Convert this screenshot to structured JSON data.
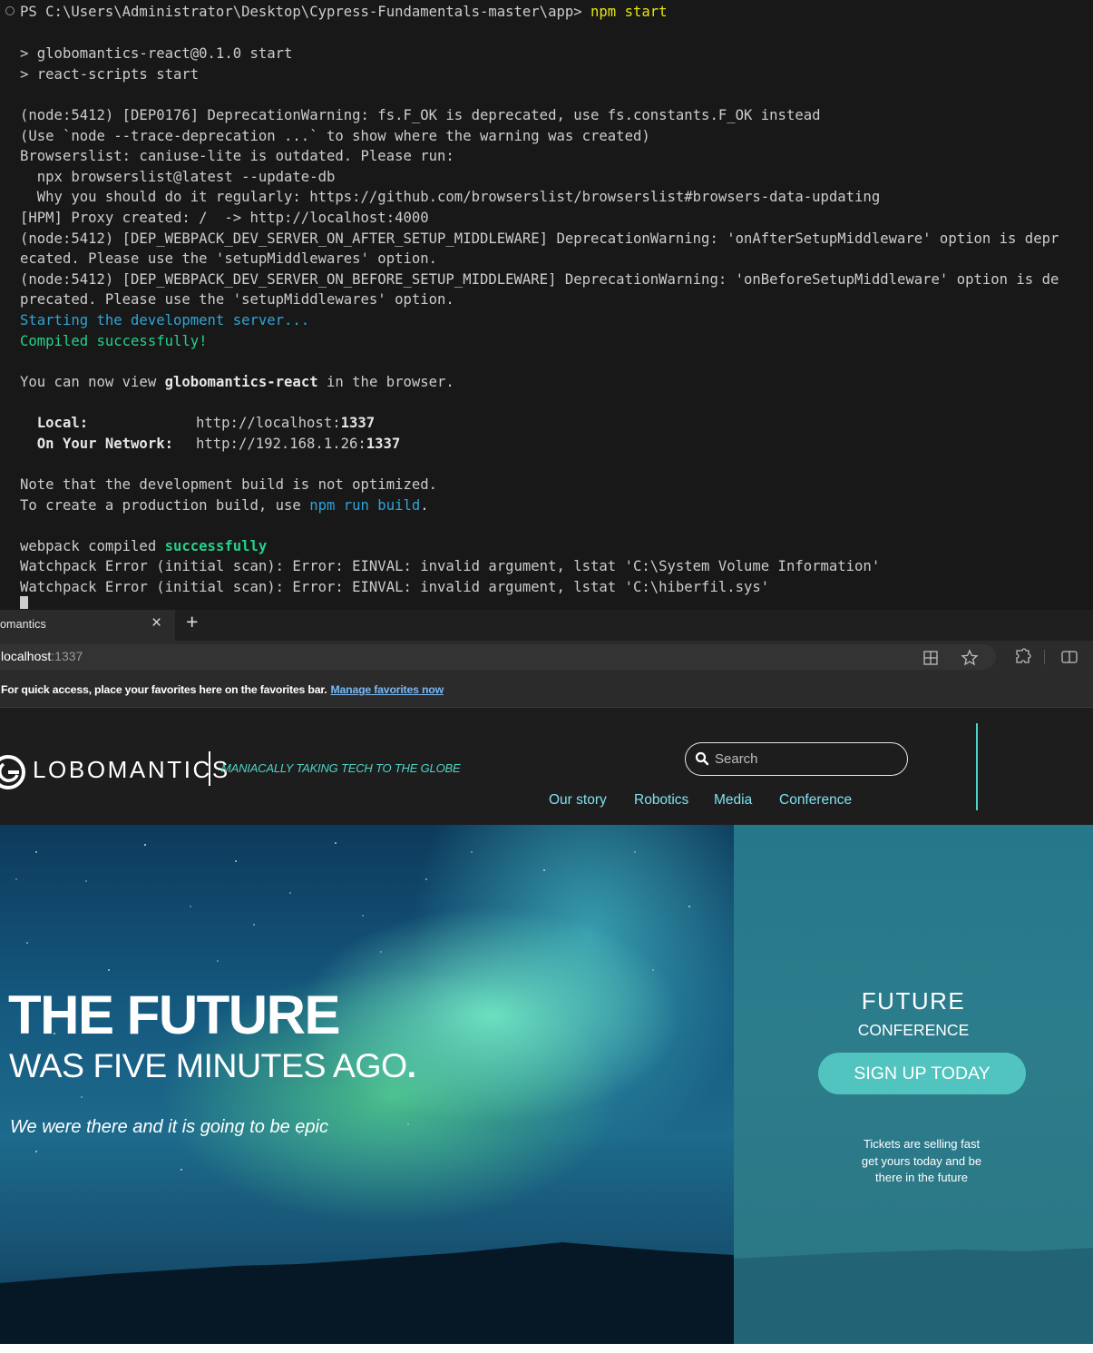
{
  "terminal": {
    "prompt_path": "PS C:\\Users\\Administrator\\Desktop\\Cypress-Fundamentals-master\\app>",
    "command": "npm start",
    "lines": {
      "l1": "> globomantics-react@0.1.0 start",
      "l2": "> react-scripts start",
      "l3": "(node:5412) [DEP0176] DeprecationWarning: fs.F_OK is deprecated, use fs.constants.F_OK instead",
      "l4": "(Use `node --trace-deprecation ...` to show where the warning was created)",
      "l5": "Browserslist: caniuse-lite is outdated. Please run:",
      "l6": "  npx browserslist@latest --update-db",
      "l7": "  Why you should do it regularly: https://github.com/browserslist/browserslist#browsers-data-updating",
      "l8": "[HPM] Proxy created: /  -> http://localhost:4000",
      "l9": "(node:5412) [DEP_WEBPACK_DEV_SERVER_ON_AFTER_SETUP_MIDDLEWARE] DeprecationWarning: 'onAfterSetupMiddleware' option is depr",
      "l10": "ecated. Please use the 'setupMiddlewares' option.",
      "l11": "(node:5412) [DEP_WEBPACK_DEV_SERVER_ON_BEFORE_SETUP_MIDDLEWARE] DeprecationWarning: 'onBeforeSetupMiddleware' option is de",
      "l12": "precated. Please use the 'setupMiddlewares' option.",
      "l13": "Starting the development server...",
      "l14": "Compiled successfully!",
      "view_prefix": "You can now view ",
      "view_app": "globomantics-react",
      "view_suffix": " in the browser.",
      "local_label": "  Local:",
      "local_url": "http://localhost:",
      "local_port": "1337",
      "network_label": "  On Your Network:",
      "network_url": "http://192.168.1.26:",
      "network_port": "1337",
      "note1": "Note that the development build is not optimized.",
      "note2_prefix": "To create a production build, use ",
      "note2_cmd": "npm run build",
      "note2_suffix": ".",
      "wp_prefix": "webpack compiled ",
      "wp_status": "successfully",
      "err1": "Watchpack Error (initial scan): Error: EINVAL: invalid argument, lstat 'C:\\System Volume Information'",
      "err2": "Watchpack Error (initial scan): Error: EINVAL: invalid argument, lstat 'C:\\hiberfil.sys'"
    }
  },
  "browser": {
    "tab_title": "omantics",
    "tab_close": "×",
    "new_tab": "+",
    "address_host": "localhost",
    "address_port": ":1337",
    "favorites_text": "For quick access, place your favorites here on the favorites bar.",
    "favorites_link": "Manage favorites now"
  },
  "site": {
    "logo_text": "LOBOMANTICS",
    "tagline": "MANIACALLY TAKING TECH TO THE GLOBE",
    "search_placeholder": "Search",
    "nav": [
      "Our story",
      "Robotics",
      "Media",
      "Conference"
    ],
    "hero_title": "THE FUTURE",
    "hero_sub": "WAS FIVE MINUTES AGO",
    "hero_dot": ".",
    "hero_tagline": "We were there and it is going to be epic",
    "panel_title": "FUTURE",
    "panel_sub": "CONFERENCE",
    "signup_label": "SIGN UP TODAY",
    "tickets_text": "Tickets are selling fast\nget yours today and be\nthere in the future"
  },
  "colors": {
    "accent_teal": "#52c4c0",
    "tagline_teal": "#4fd3c6",
    "terminal_bg": "#181818"
  }
}
